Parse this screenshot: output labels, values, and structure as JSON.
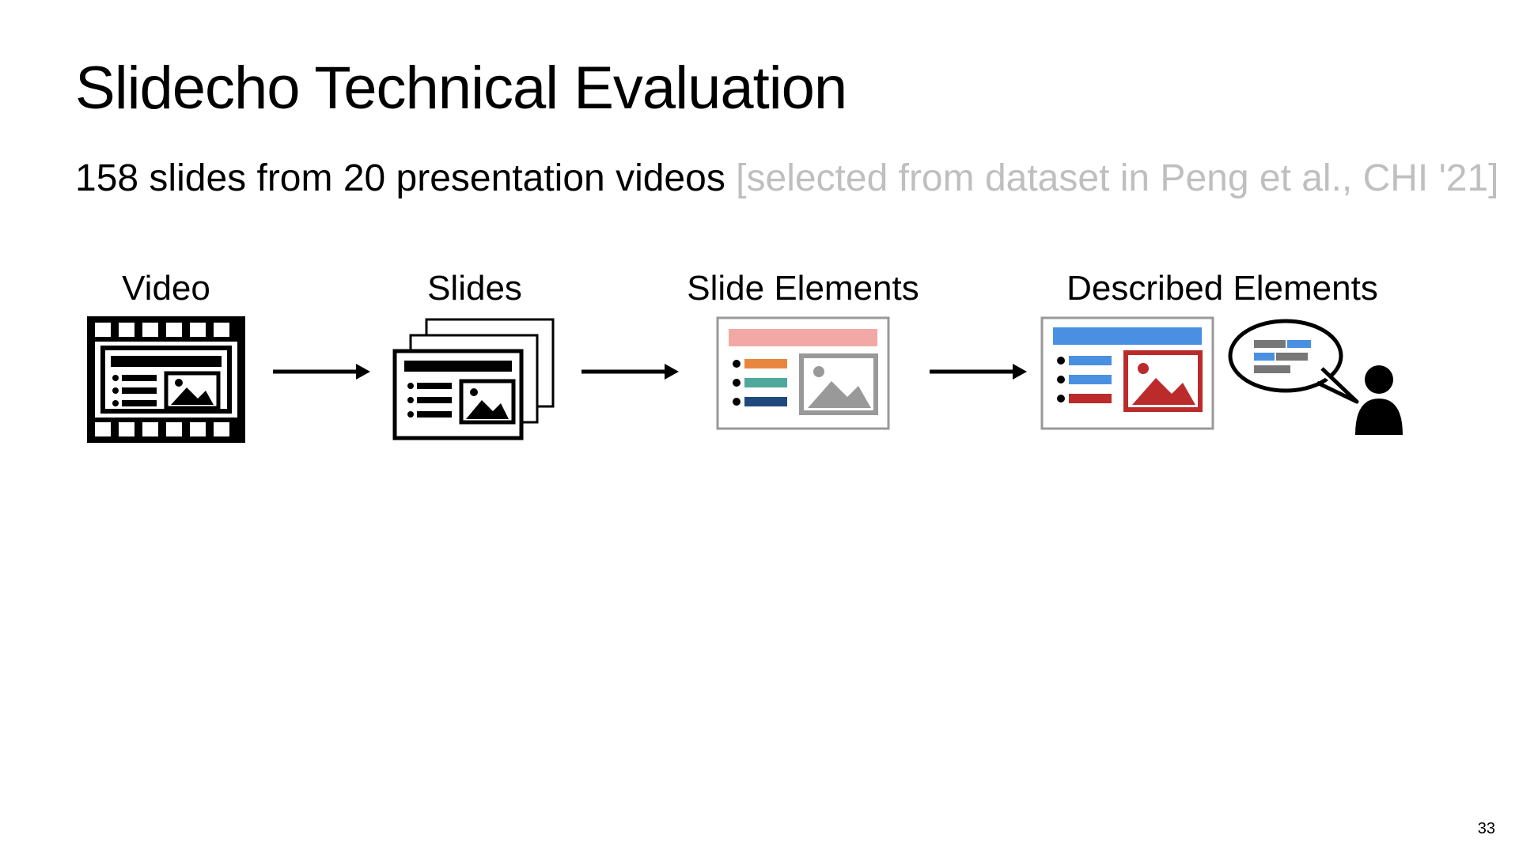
{
  "title": "Slidecho Technical Evaluation",
  "subtitle_main": "158 slides from 20 presentation videos ",
  "subtitle_gray": "[selected from dataset in Peng et al., CHI '21]",
  "stages": {
    "video": "Video",
    "slides": "Slides",
    "slide_elements": "Slide Elements",
    "described_elements": "Described Elements"
  },
  "page_number": "33"
}
